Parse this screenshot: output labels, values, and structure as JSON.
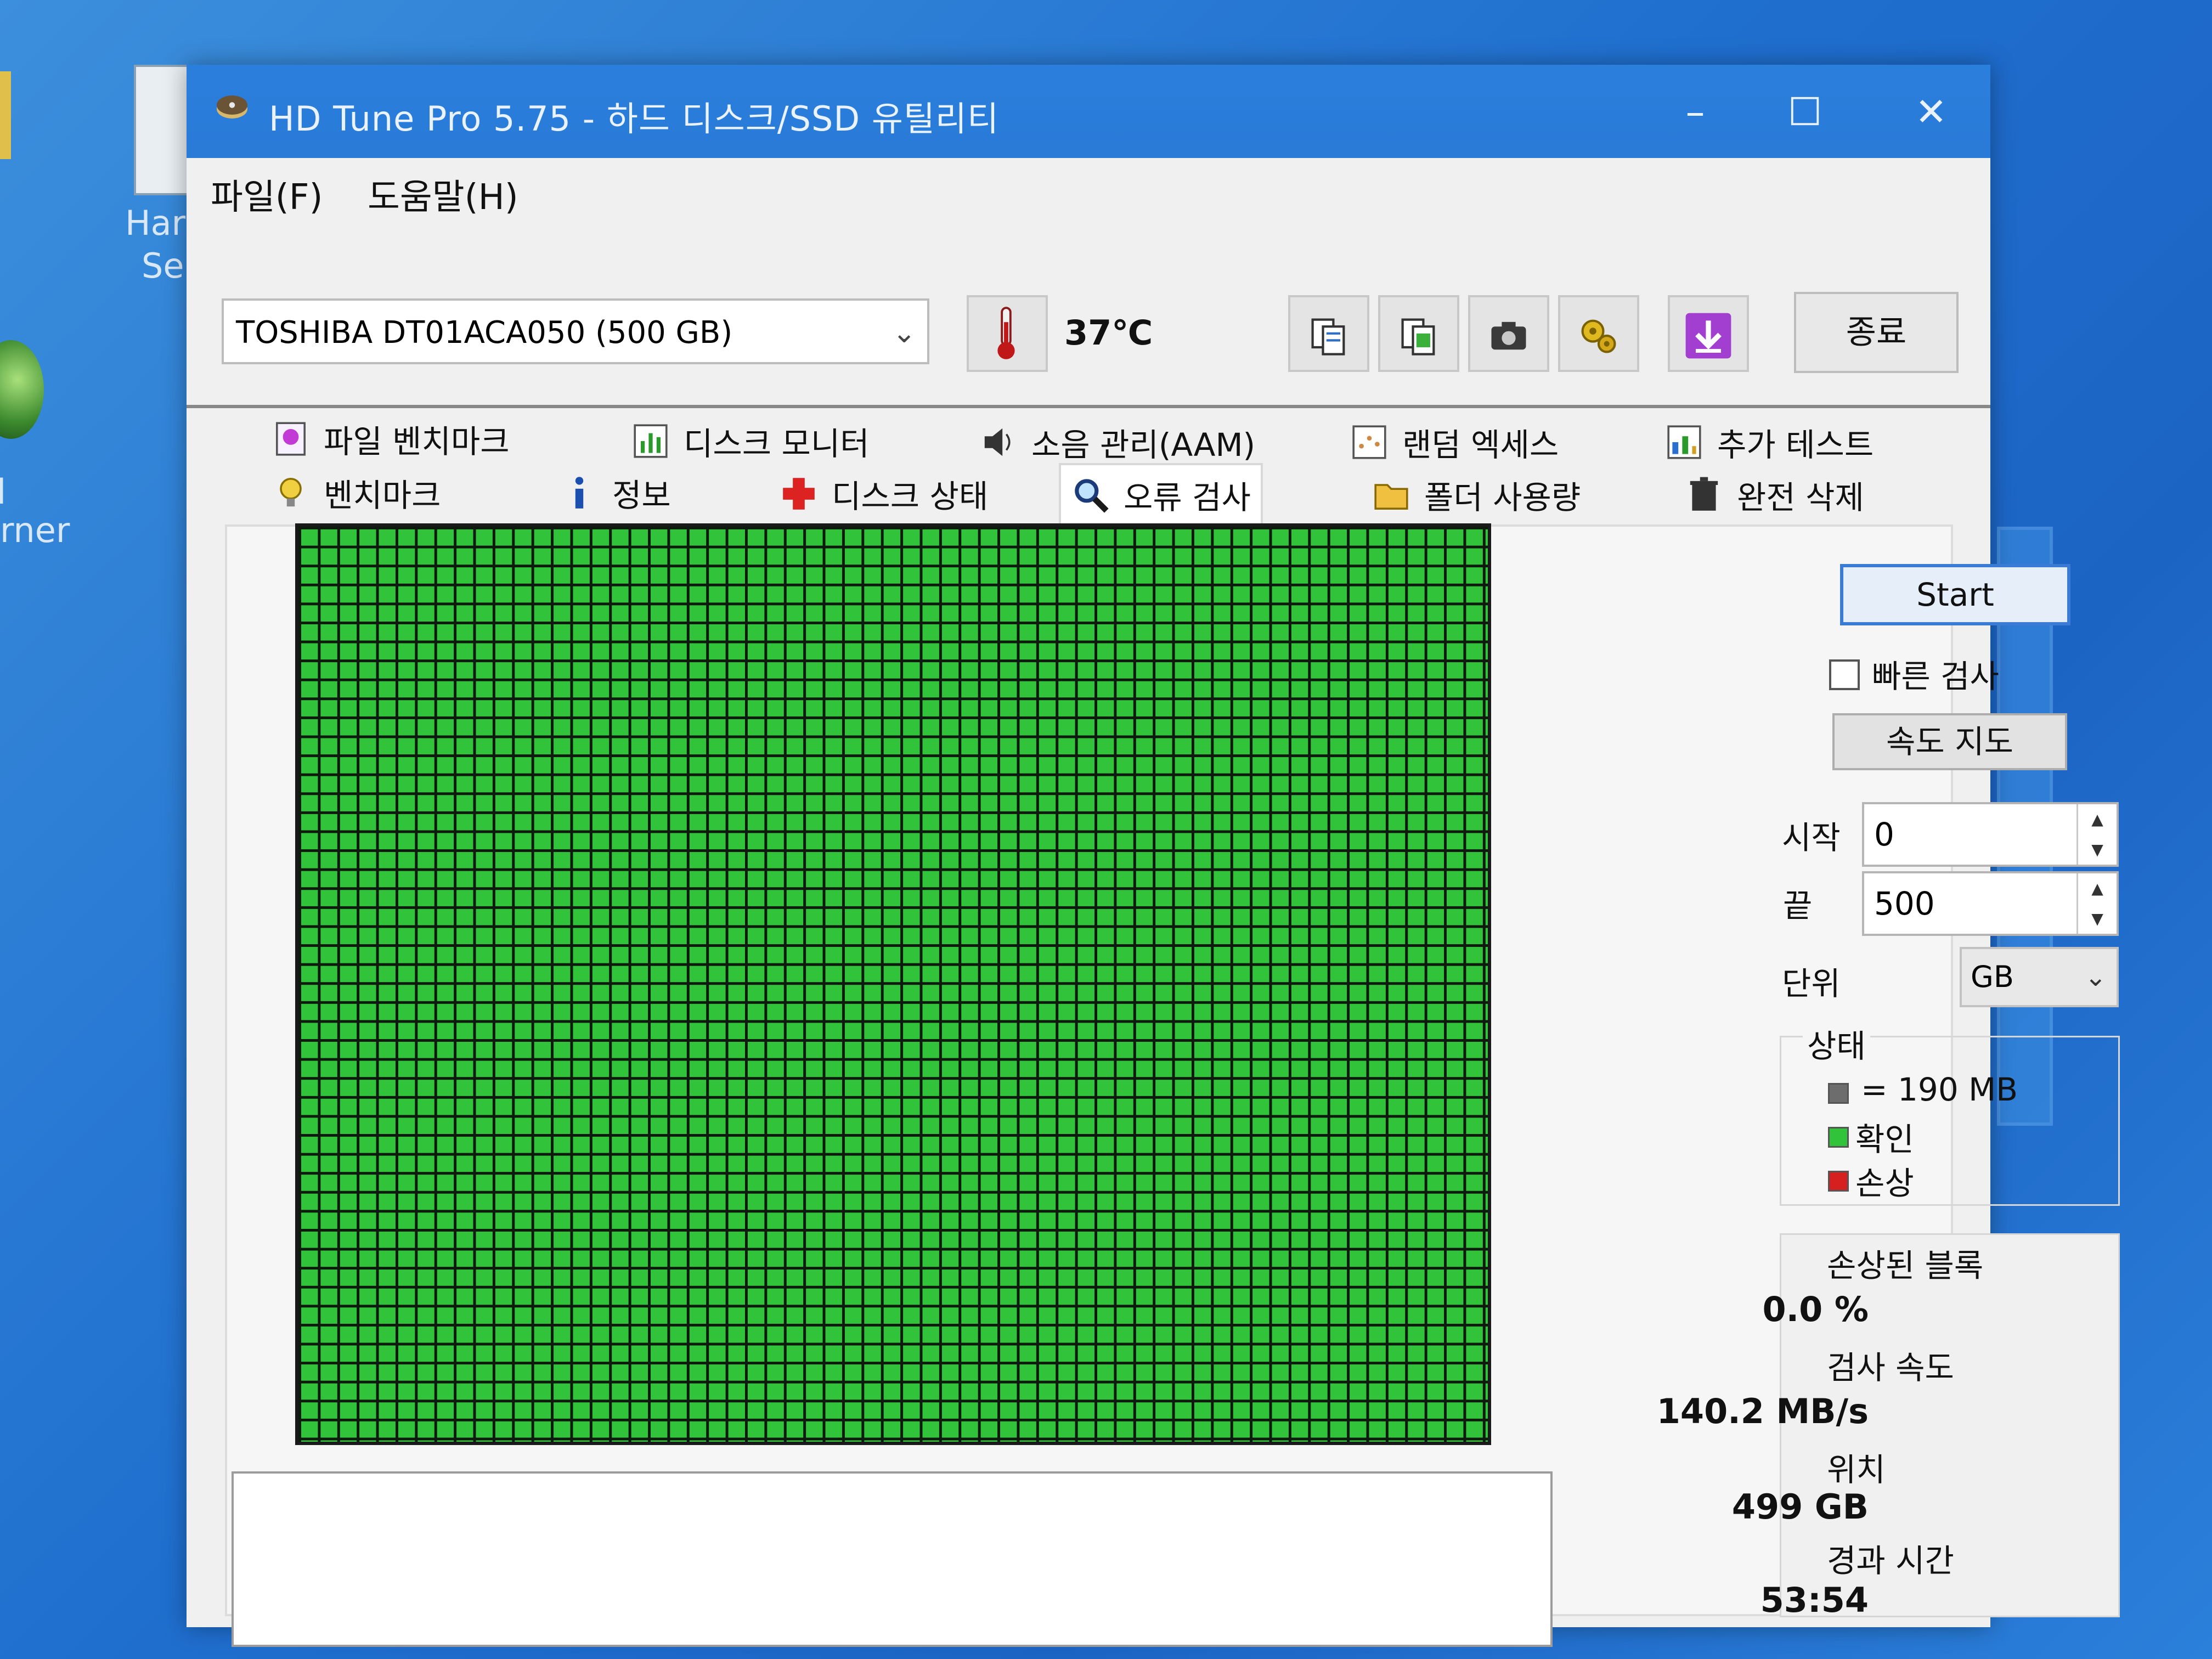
{
  "desktop": {
    "left_icon_text_1": "Har",
    "left_icon_text_2": "Ser",
    "left_icon_text_3": "rner",
    "left_edge_char": "l"
  },
  "window": {
    "title": "HD Tune Pro 5.75 - 하드 디스크/SSD 유틸리티",
    "controls": {
      "minimize": "–",
      "maximize": "☐",
      "close": "✕"
    }
  },
  "menu": [
    {
      "label": "파일(F)"
    },
    {
      "label": "도움말(H)"
    }
  ],
  "toolbar": {
    "drive": "TOSHIBA DT01ACA050 (500 GB)",
    "temperature": "37℃",
    "exit_label": "종료"
  },
  "tabs": {
    "row1": [
      "파일 벤치마크",
      "디스크 모니터",
      "소음 관리(AAM)",
      "랜덤 엑세스",
      "추가 테스트"
    ],
    "row2": [
      "벤치마크",
      "정보",
      "디스크 상태",
      "오류 검사",
      "폴더 사용량",
      "완전 삭제"
    ],
    "selected": "오류 검사"
  },
  "scan": {
    "start_label": "Start",
    "quick_scan_label": "빠른 검사",
    "quick_scan_checked": false,
    "speed_map_label": "속도 지도",
    "start_field_label": "시작",
    "start_value": "0",
    "end_field_label": "끝",
    "end_value": "500",
    "unit_label": "단위",
    "unit_value": "GB",
    "legend_title": "상태",
    "legend_block": "= 190 MB",
    "legend_ok": "확인",
    "legend_damaged": "손상",
    "colors": {
      "ok": "#31c43b",
      "damaged": "#d61f1f",
      "block": "#6d6d6d",
      "accent": "#2a7ad8"
    }
  },
  "stats": {
    "damaged_label": "손상된 블록",
    "damaged_value": "0.0 %",
    "speed_label": "검사 속도",
    "speed_value": "140.2 MB/s",
    "position_label": "위치",
    "position_value": "499 GB",
    "elapsed_label": "경과 시간",
    "elapsed_value": "53:54"
  }
}
